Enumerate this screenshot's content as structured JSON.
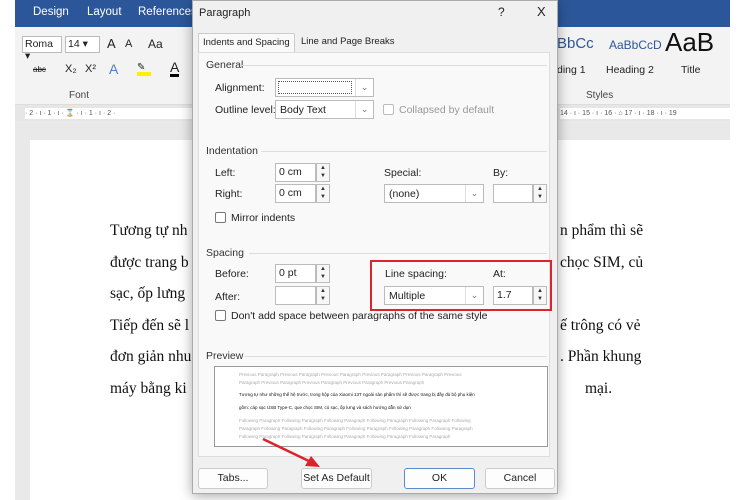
{
  "ribbon": {
    "tabs": [
      "Design",
      "Layout",
      "References"
    ],
    "font_name": "Roma",
    "font_size": "14",
    "grow": "A",
    "shrink": "A",
    "case": "Aa",
    "strike": "abc",
    "sub": "X₂",
    "sup": "X²",
    "group_font": "Font",
    "group_styles": "Styles",
    "styles": [
      {
        "sample": "BbCc",
        "name": "ding 1"
      },
      {
        "sample": "AaBbCcD",
        "name": "Heading 2"
      },
      {
        "sample": "AaB",
        "name": "Title"
      }
    ],
    "ruler_left": "· 2 · ı · 1 · ı · ⌛ · ı · 1 · ı · 2 ·",
    "ruler_right": "14 · ı · 15 · ı · 16 · ⌂ 17 · ı · 18 · ı · 19"
  },
  "document": {
    "left_lines": [
      "Tương tự nh",
      "được trang b",
      "sạc, ốp lưng",
      "Tiếp đến sẽ l",
      "đơn giản nhu",
      "máy bằng ki"
    ],
    "right_lines": [
      "n phẩm thì sẽ",
      "chọc SIM, củ",
      "",
      "ế trông có vẻ",
      ". Phần khung",
      "mại."
    ]
  },
  "dialog": {
    "title": "Paragraph",
    "help": "?",
    "close": "X",
    "tabs": [
      {
        "label": "Indents and Spacing",
        "active": true
      },
      {
        "label": "Line and Page Breaks",
        "active": false
      }
    ],
    "general": {
      "label": "General",
      "alignment_label": "Alignment:",
      "alignment_value": "",
      "outline_label": "Outline level:",
      "outline_value": "Body Text",
      "collapsed_label": "Collapsed by default",
      "collapsed_checked": false
    },
    "indentation": {
      "label": "Indentation",
      "left_label": "Left:",
      "left_value": "0 cm",
      "right_label": "Right:",
      "right_value": "0 cm",
      "special_label": "Special:",
      "special_value": "(none)",
      "by_label": "By:",
      "by_value": "",
      "mirror_label": "Mirror indents",
      "mirror_checked": false
    },
    "spacing": {
      "label": "Spacing",
      "before_label": "Before:",
      "before_value": "0 pt",
      "after_label": "After:",
      "after_value": "",
      "line_spacing_label": "Line spacing:",
      "line_spacing_value": "Multiple",
      "at_label": "At:",
      "at_value": "1.7",
      "dont_add_label": "Don't add space between paragraphs of the same style",
      "dont_add_checked": false
    },
    "preview": {
      "label": "Preview",
      "previous": [
        "Previous Paragraph Previous Paragraph Previous Paragraph Previous Paragraph Previous Paragraph Previous",
        "Paragraph Previous Paragraph Previous Paragraph Previous Paragraph Previous Paragraph"
      ],
      "current": [
        "Tương tự như những thế hệ trước, trong hộp của Xiaomi 13T ngoài sản phẩm thì sẽ được trang bị đầy đủ bộ phụ kiện",
        "gồm: cáp sạc USB Type-C, que chọc SIM, củ sạc, ốp lưng và sách hướng dẫn sử dụn"
      ],
      "following": [
        "Following Paragraph Following Paragraph Following Paragraph Following Paragraph Following Paragraph Following",
        "Paragraph Following Paragraph Following Paragraph Following Paragraph Following Paragraph Following Paragraph",
        "Following Paragraph Following Paragraph Following Paragraph Following Paragraph Following Paragraph"
      ]
    },
    "buttons": {
      "tabs": "Tabs...",
      "set_default": "Set As Default",
      "ok": "OK",
      "cancel": "Cancel"
    }
  },
  "colors": {
    "ribbon_blue": "#2b579a",
    "highlight_red": "#d9252b"
  }
}
